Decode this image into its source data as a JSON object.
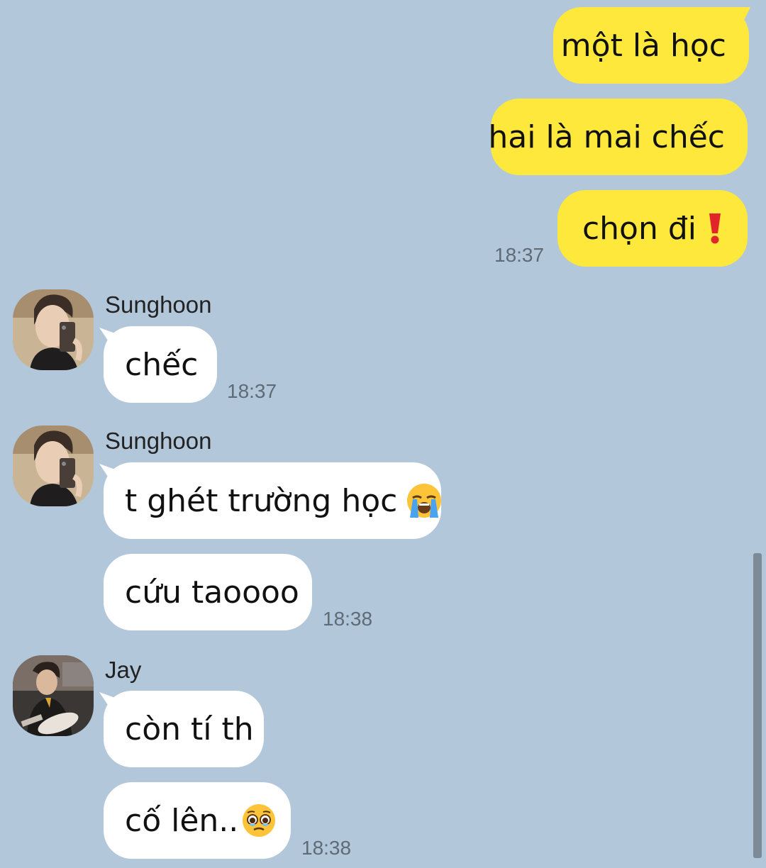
{
  "messages": {
    "out": [
      {
        "text": "một là học"
      },
      {
        "text": "hai là mai chếc"
      },
      {
        "text": "chọn đi",
        "emoji": "red-exclamation-mark",
        "time": "18:37"
      }
    ],
    "group1": {
      "sender": "Sunghoon",
      "avatar": "selfie-avatar",
      "bubbles": [
        {
          "text": "chếc",
          "time": "18:37"
        }
      ]
    },
    "group2": {
      "sender": "Sunghoon",
      "avatar": "selfie-avatar",
      "bubbles": [
        {
          "text": "t ghét trường học",
          "emoji": "loudly-crying-face"
        },
        {
          "text": "cứu taoooo",
          "time": "18:38"
        }
      ]
    },
    "group3": {
      "sender": "Jay",
      "avatar": "guitar-player-avatar",
      "bubbles": [
        {
          "text": "còn tí th"
        },
        {
          "text": "cố lên..",
          "emoji": "pleading-face-with-tears",
          "time": "18:38"
        }
      ]
    }
  },
  "colors": {
    "background": "#b2c7da",
    "outgoing_bubble": "#fee83b",
    "incoming_bubble": "#ffffff",
    "timestamp": "#5f6b77"
  }
}
